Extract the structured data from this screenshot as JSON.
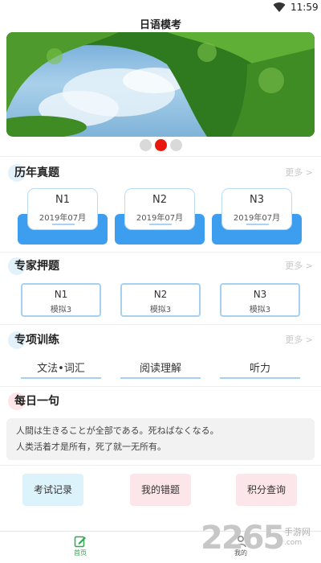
{
  "status": {
    "time": "11:59"
  },
  "app": {
    "title": "日语模考"
  },
  "banner": {
    "active_index": 1,
    "count": 3
  },
  "past_papers": {
    "title": "历年真题",
    "more": "更多 >",
    "items": [
      {
        "level": "N1",
        "date": "2019年07月"
      },
      {
        "level": "N2",
        "date": "2019年07月"
      },
      {
        "level": "N3",
        "date": "2019年07月"
      }
    ]
  },
  "expert": {
    "title": "专家押题",
    "more": "更多 >",
    "items": [
      {
        "level": "N1",
        "sub": "模拟3"
      },
      {
        "level": "N2",
        "sub": "模拟3"
      },
      {
        "level": "N3",
        "sub": "模拟3"
      }
    ]
  },
  "training": {
    "title": "专项训练",
    "more": "更多 >",
    "items": [
      "文法•词汇",
      "阅读理解",
      "听力"
    ]
  },
  "daily": {
    "title": "每日一句",
    "japanese": "人間は生きることが全部である。死ねばなくなる。",
    "chinese": "人类活着才是所有，死了就一无所有。"
  },
  "actions": {
    "records": "考试记录",
    "mistakes": "我的错题",
    "points": "积分查询"
  },
  "tabs": {
    "home": "首页",
    "mine": "我的"
  },
  "watermark": {
    "number": "2265",
    "site": "手游网",
    "url": ".com"
  },
  "colors": {
    "accent_blue": "#3d9ef0",
    "active_dot": "#e8180f",
    "active_tab": "#2fa84f"
  }
}
